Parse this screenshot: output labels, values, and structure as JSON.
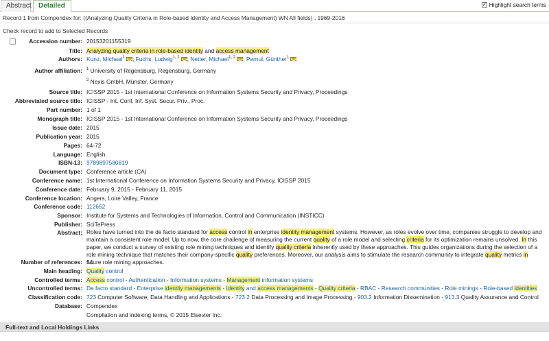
{
  "tabs": [
    {
      "label": "Abstract"
    },
    {
      "label": "Detailed"
    }
  ],
  "highlight_toggle": {
    "label": "Highlight search terms",
    "checked": true
  },
  "record_line": "Record 1 from Compendex for: ((Analyzing Quality Criteria in Role-based Identity and Access Management) WN All fields) , 1969-2016",
  "check_hint": "Check record to add to Selected Records",
  "fields": {
    "accession": {
      "label": "Accession number:",
      "value": "20153201155319"
    },
    "title": {
      "label": "Title:",
      "parts": [
        "Analyzing quality criteria in role-based identity",
        " and ",
        "access management"
      ]
    },
    "authors": {
      "label": "Authors:",
      "items": [
        {
          "name": "Kunz, Michael",
          "sup": "1"
        },
        {
          "name": "Fuchs, Ludwig",
          "sup": "1, 2"
        },
        {
          "name": "Netter, Michael",
          "sup": "1, 2"
        },
        {
          "name": "Pernul, Günther",
          "sup": "1"
        }
      ]
    },
    "affiliation": {
      "label": "Author affiliation:",
      "items": [
        {
          "sup": "1",
          "text": "University of Regensburg, Regensburg, Germany"
        },
        {
          "sup": "2",
          "text": "Nexis GmbH, Münster, Germany"
        }
      ]
    },
    "source_title": {
      "label": "Source title:",
      "value": "ICISSP 2015 - 1st International Conference on Information Systems Security and Privacy, Proceedings"
    },
    "abbr_source": {
      "label": "Abbreviated source title:",
      "value": "ICISSP - Int. Conf. Inf. Syst. Secur. Priv., Proc."
    },
    "part_number": {
      "label": "Part number:",
      "value": "1 of 1"
    },
    "monograph": {
      "label": "Monograph title:",
      "value": "ICISSP 2015 - 1st International Conference on Information Systems Security and Privacy, Proceedings"
    },
    "issue_date": {
      "label": "Issue date:",
      "value": "2015"
    },
    "pub_year": {
      "label": "Publication year:",
      "value": "2015"
    },
    "pages": {
      "label": "Pages:",
      "value": "64-72"
    },
    "language": {
      "label": "Language:",
      "value": "English"
    },
    "isbn": {
      "label": "ISBN-13:",
      "value": "9789897580819"
    },
    "doc_type": {
      "label": "Document type:",
      "value": "Conference article (CA)"
    },
    "conf_name": {
      "label": "Conference name:",
      "value": "1st International Conference on Information Systems Security and Privacy, ICISSP 2015"
    },
    "conf_date": {
      "label": "Conference date:",
      "value": "February 9, 2015 - February 11, 2015"
    },
    "conf_loc": {
      "label": "Conference location:",
      "value": "Angers, Loire Valley, France"
    },
    "conf_code": {
      "label": "Conference code:",
      "value": "112652"
    },
    "sponsor": {
      "label": "Sponsor:",
      "value": "Institute for Systems and Technologies of Information, Control and Communication (INSTICC)"
    },
    "publisher": {
      "label": "Publisher:",
      "value": "SciTePress"
    },
    "abstract": {
      "label": "Abstract:",
      "segments": [
        {
          "t": "Roles have turned into the de facto standard for ",
          "h": false
        },
        {
          "t": "access",
          "h": true
        },
        {
          "t": " control ",
          "h": false
        },
        {
          "t": "in",
          "h": true
        },
        {
          "t": " enterprise ",
          "h": false
        },
        {
          "t": "identity management",
          "h": true
        },
        {
          "t": " systems. However, as roles evolve over time, companies struggle to develop and maintain a consistent role model. Up to now, the core challenge of measuring the current ",
          "h": false
        },
        {
          "t": "quality",
          "h": true
        },
        {
          "t": " of a role model and selecting ",
          "h": false
        },
        {
          "t": "criteria",
          "h": true
        },
        {
          "t": " for its optimization remains unsolved. ",
          "h": false
        },
        {
          "t": "In",
          "h": true
        },
        {
          "t": " this paper, we conduct a survey of existing role mining techniques and identify ",
          "h": false
        },
        {
          "t": "quality criteria",
          "h": true
        },
        {
          "t": " inherently used by these approaches. This guides organizations during the selection of a role mining technique that matches their company-specific ",
          "h": false
        },
        {
          "t": "quality",
          "h": true
        },
        {
          "t": " preferences. Moreover, our analysis aims to stimulate the research community to integrate ",
          "h": false
        },
        {
          "t": "quality",
          "h": true
        },
        {
          "t": " metrics ",
          "h": false
        },
        {
          "t": "in",
          "h": true
        },
        {
          "t": " future role mining approaches.",
          "h": false
        }
      ]
    },
    "num_refs": {
      "label": "Number of references:",
      "value": "64"
    },
    "main_heading": {
      "label": "Main heading:",
      "parts": [
        "Quality",
        " control"
      ]
    },
    "controlled": {
      "label": "Controlled terms:",
      "items": [
        [
          {
            "t": "Access",
            "h": true
          },
          {
            "t": " control",
            "h": false
          }
        ],
        [
          {
            "t": "Authentication",
            "h": false
          }
        ],
        [
          {
            "t": "Information systems",
            "h": false
          }
        ],
        [
          {
            "t": "Management",
            "h": true
          },
          {
            "t": " information systems",
            "h": false
          }
        ]
      ]
    },
    "uncontrolled": {
      "label": "Uncontrolled terms:",
      "items": [
        [
          {
            "t": "De facto standard",
            "h": false
          }
        ],
        [
          {
            "t": "Enterprise ",
            "h": false
          },
          {
            "t": "identity managements",
            "h": true
          }
        ],
        [
          {
            "t": "Identity",
            "h": true
          },
          {
            "t": " and ",
            "h": false
          },
          {
            "t": "access managements",
            "h": true
          }
        ],
        [
          {
            "t": "Quality criteria",
            "h": true
          }
        ],
        [
          {
            "t": "RBAC",
            "h": false
          }
        ],
        [
          {
            "t": "Research communities",
            "h": false
          }
        ],
        [
          {
            "t": "Role minings",
            "h": false
          }
        ],
        [
          {
            "t": "Role-based ",
            "h": false
          },
          {
            "t": "identities",
            "h": true
          }
        ]
      ]
    },
    "classification": {
      "label": "Classification code:",
      "items": [
        {
          "code": "723",
          "text": " Computer Software, Data Handling and Applications"
        },
        {
          "code": "723.2",
          "text": " Data Processing and Image Processing"
        },
        {
          "code": "903.2",
          "text": " Information Dissemination"
        },
        {
          "code": "913.3",
          "text": " Quality Assurance and Control"
        }
      ]
    },
    "database": {
      "label": "Database:",
      "value": "Compendex"
    },
    "copyright": "Compilation and indexing terms, © 2015 Elsevier Inc."
  },
  "footer_bar": "Full-text and Local Holdings Links",
  "colors": {
    "highlight": "#f6ef82",
    "link": "#1a5ea9",
    "tab_active": "#2e7d32"
  }
}
